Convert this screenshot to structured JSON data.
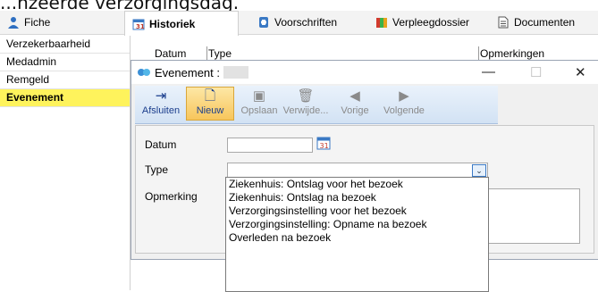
{
  "caption": "...nzeerde verzorgingsdag.",
  "tabs": [
    {
      "label": "Fiche",
      "icon": "user-icon"
    },
    {
      "label": "Historiek",
      "icon": "calendar-icon"
    },
    {
      "label": "Voorschriften",
      "icon": "prescription-icon"
    },
    {
      "label": "Verpleegdossier",
      "icon": "books-icon"
    },
    {
      "label": "Documenten",
      "icon": "document-icon"
    }
  ],
  "sidebar": {
    "items": [
      {
        "label": "Verzekerbaarheid"
      },
      {
        "label": "Medadmin"
      },
      {
        "label": "Remgeld"
      },
      {
        "label": "Evenement",
        "selected": true
      }
    ]
  },
  "grid": {
    "columns": [
      "Datum",
      "Type",
      "Opmerkingen"
    ]
  },
  "dialog": {
    "title": "Evenement :",
    "toolbar": [
      {
        "label": "Afsluiten",
        "icon": "exit-icon",
        "state": "enabled"
      },
      {
        "label": "Nieuw",
        "icon": "new-document-icon",
        "state": "active"
      },
      {
        "label": "Opslaan",
        "icon": "save-icon",
        "state": "disabled"
      },
      {
        "label": "Verwijde...",
        "icon": "trash-icon",
        "state": "disabled"
      },
      {
        "label": "Vorige",
        "icon": "arrow-left-icon",
        "state": "disabled"
      },
      {
        "label": "Volgende",
        "icon": "arrow-right-icon",
        "state": "disabled"
      }
    ],
    "form": {
      "date_label": "Datum",
      "date_value": "",
      "type_label": "Type",
      "type_value": "",
      "remark_label": "Opmerking"
    },
    "type_options": [
      "Ziekenhuis: Ontslag voor het bezoek",
      "Ziekenhuis: Ontslag na bezoek",
      "Verzorgingsinstelling voor het bezoek",
      "Verzorgingsinstelling: Opname na bezoek",
      "Overleden na bezoek"
    ]
  },
  "colors": {
    "selected_sidebar": "#fef35c",
    "toolbar_blue": "#d2e2f4",
    "active_button": "#f7c65c"
  }
}
